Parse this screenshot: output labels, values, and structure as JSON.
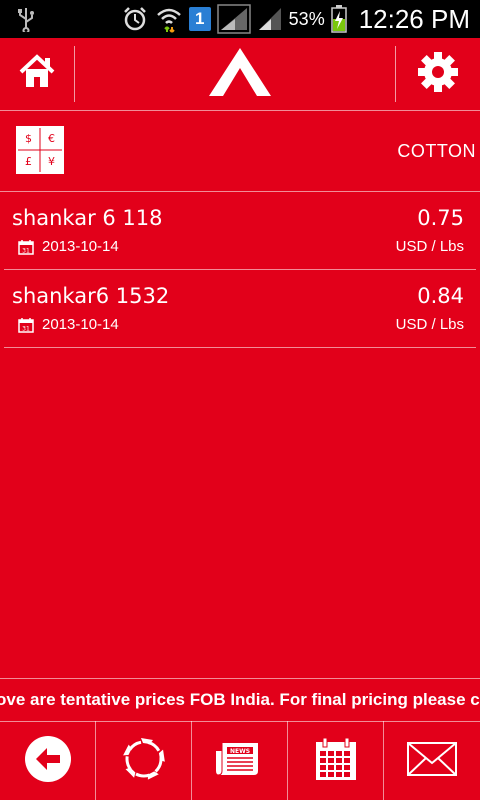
{
  "status_bar": {
    "icons": [
      "usb-icon",
      "alarm-icon",
      "wifi-icon",
      "sim-1-icon",
      "signal-icon",
      "signal-icon-2",
      "battery-charging-icon"
    ],
    "sim_label": "1",
    "battery": "53%",
    "time": "12:26 PM"
  },
  "header": {
    "left_icon": "home-icon",
    "logo": "tent-logo",
    "right_icon": "gear-icon"
  },
  "subheader": {
    "currency_symbols": [
      "$",
      "€",
      "£",
      "¥"
    ],
    "commodity": "COTTON"
  },
  "prices": [
    {
      "name": "shankar 6 118",
      "date": "2013-10-14",
      "price": "0.75",
      "unit": "USD / Lbs"
    },
    {
      "name": "shankar6 1532",
      "date": "2013-10-14",
      "price": "0.84",
      "unit": "USD / Lbs"
    }
  ],
  "calendar_day": "31",
  "ticker": "ove are tentative prices FOB India. For final pricing please co",
  "bottom_nav": [
    {
      "icon": "back-arrow-icon"
    },
    {
      "icon": "refresh-icon"
    },
    {
      "icon": "news-icon",
      "label": "NEWS"
    },
    {
      "icon": "calendar-icon"
    },
    {
      "icon": "mail-icon"
    }
  ],
  "colors": {
    "background": "#e2001a",
    "foreground": "#ffffff",
    "status_bar": "#000000",
    "sim_badge": "#2a7fd4",
    "battery_charge": "#7ac70c"
  }
}
